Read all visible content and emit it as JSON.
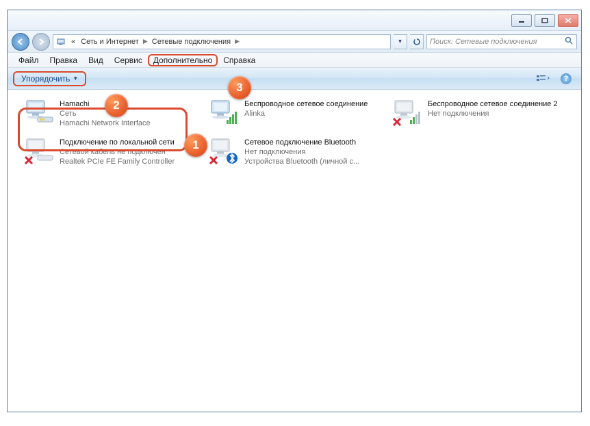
{
  "breadcrumb": {
    "prefix": "«",
    "seg1": "Сеть и Интернет",
    "seg2": "Сетевые подключения"
  },
  "search": {
    "placeholder": "Поиск: Сетевые подключения"
  },
  "menu": {
    "file": "Файл",
    "edit": "Правка",
    "view": "Вид",
    "tools": "Сервис",
    "advanced": "Дополнительно",
    "help": "Справка"
  },
  "cmd": {
    "organize": "Упорядочить"
  },
  "connections": {
    "hamachi": {
      "name": "Hamachi",
      "l2": "Сеть",
      "l3": "Hamachi Network Interface"
    },
    "wifi": {
      "name": "Беспроводное сетевое соединение",
      "l2": "Alinka",
      "l3": ""
    },
    "wifi2": {
      "name": "Беспроводное сетевое соединение 2",
      "l2": "Нет подключения",
      "l3": ""
    },
    "lan": {
      "name": "Подключение по локальной сети",
      "l2": "Сетевой кабель не подключен",
      "l3": "Realtek PCIe FE Family Controller"
    },
    "bt": {
      "name": "Сетевое подключение Bluetooth",
      "l2": "Нет подключения",
      "l3": "Устройства Bluetooth (личной с..."
    }
  },
  "callouts": {
    "b1": "1",
    "b2": "2",
    "b3": "3"
  }
}
